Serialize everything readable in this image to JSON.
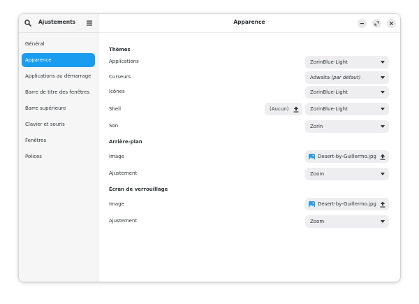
{
  "sidebar": {
    "title": "Ajustements",
    "items": [
      {
        "label": "Général",
        "selected": false
      },
      {
        "label": "Apparence",
        "selected": true
      },
      {
        "label": "Applications au démarrage",
        "selected": false
      },
      {
        "label": "Barre de titre des fenêtres",
        "selected": false
      },
      {
        "label": "Barre supérieure",
        "selected": false
      },
      {
        "label": "Clavier et souris",
        "selected": false
      },
      {
        "label": "Fenêtres",
        "selected": false
      },
      {
        "label": "Polices",
        "selected": false
      }
    ]
  },
  "header": {
    "title": "Apparence"
  },
  "themes": {
    "section": "Thèmes",
    "applications": {
      "label": "Applications",
      "value": "ZorinBlue-Light"
    },
    "cursors": {
      "label": "Curseurs",
      "value": "Adwaita",
      "suffix": "(par défaut)"
    },
    "icons": {
      "label": "Icônes",
      "value": "ZorinBlue-Light"
    },
    "shell": {
      "label": "Shell",
      "file_value": "(Aucun)",
      "value": "ZorinBlue-Light"
    },
    "sound": {
      "label": "Son",
      "value": "Zorin"
    }
  },
  "background": {
    "section": "Arrière-plan",
    "image": {
      "label": "Image",
      "value": "Desert-by-Guillermo.jpg"
    },
    "adjust": {
      "label": "Ajustement",
      "value": "Zoom"
    }
  },
  "lockscreen": {
    "section": "Écran de verrouillage",
    "image": {
      "label": "Image",
      "value": "Desert-by-Guillermo.jpg"
    },
    "adjust": {
      "label": "Ajustement",
      "value": "Zoom"
    }
  },
  "colors": {
    "accent": "#1a9cf0",
    "file_icon": "#2b9be0"
  }
}
